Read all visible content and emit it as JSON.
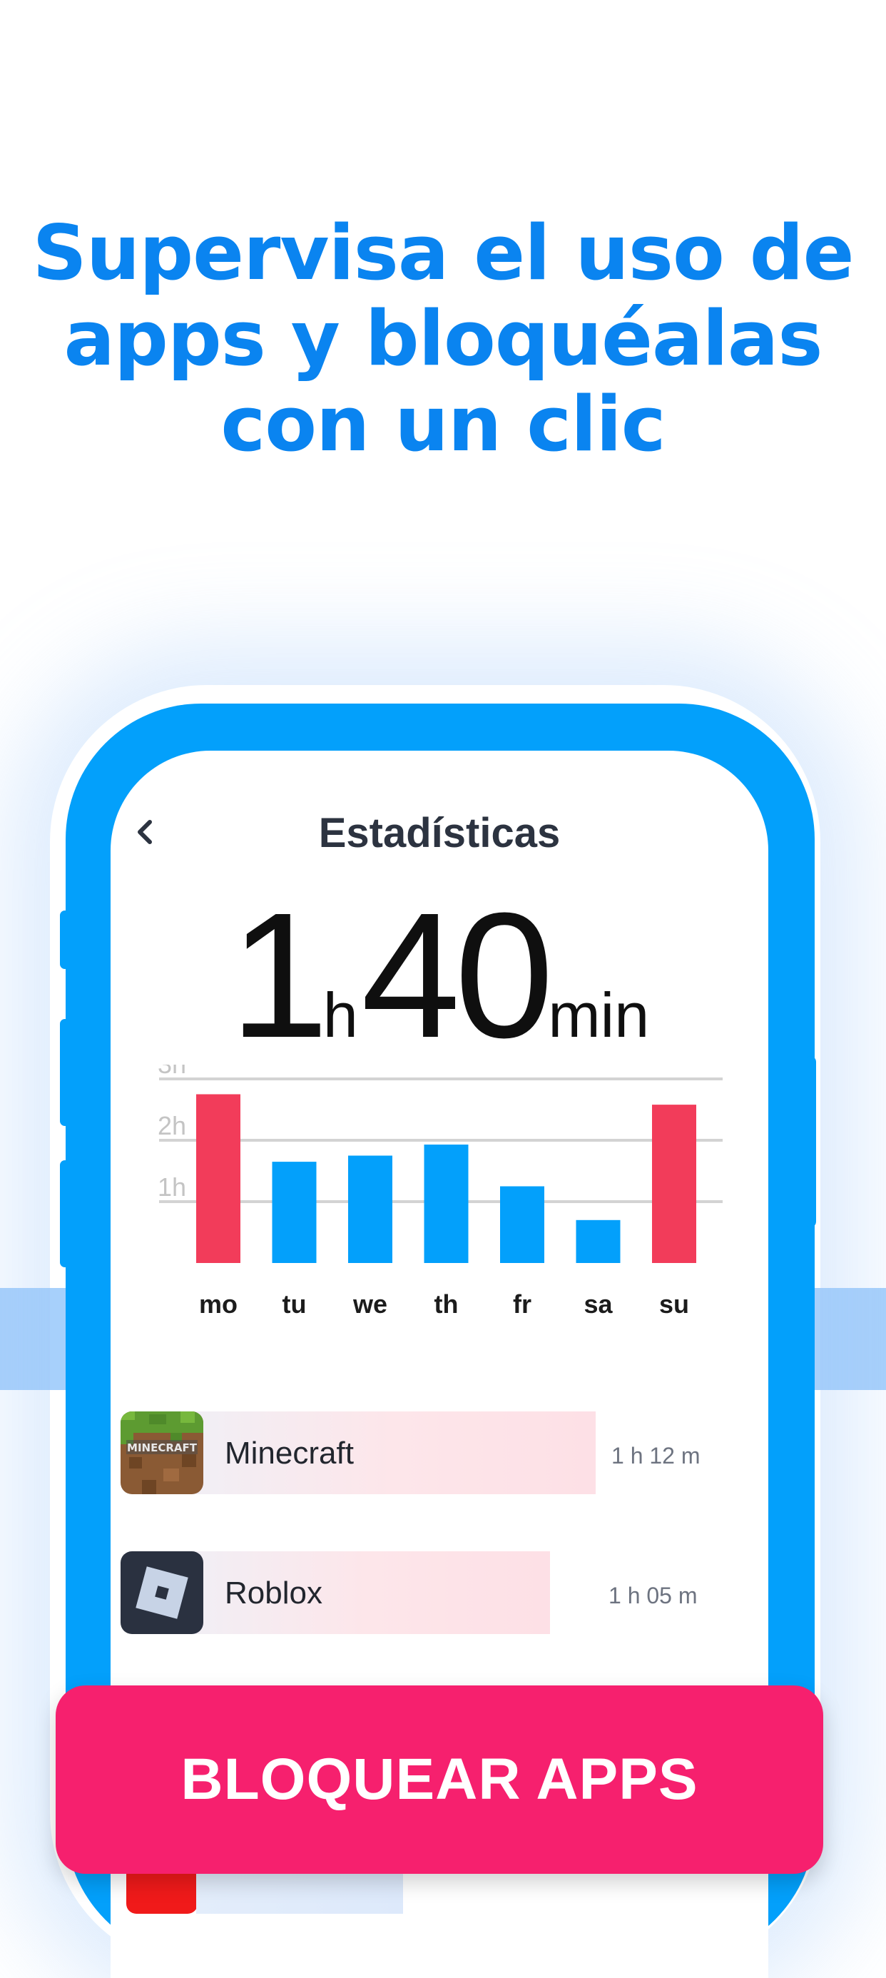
{
  "headline": {
    "line1": "Supervisa el uso de",
    "line2": "apps y bloquéalas",
    "line3": "con un clic"
  },
  "screen": {
    "title": "Estadísticas",
    "back_icon": "chevron-left-icon",
    "total": {
      "hours": "1",
      "hours_unit": "h",
      "minutes": "40",
      "minutes_unit": "min"
    }
  },
  "chart_data": {
    "type": "bar",
    "categories": [
      "mo",
      "tu",
      "we",
      "th",
      "fr",
      "sa",
      "su"
    ],
    "values": [
      2.75,
      1.65,
      1.75,
      1.93,
      1.25,
      0.7,
      2.58
    ],
    "y_ticks": [
      "1h",
      "2h",
      "3h"
    ],
    "ylim": [
      0,
      3
    ],
    "colors": [
      "#f23c5a",
      "#03a0fb",
      "#03a0fb",
      "#03a0fb",
      "#03a0fb",
      "#03a0fb",
      "#f23c5a"
    ],
    "grid": true
  },
  "apps": [
    {
      "name": "Minecraft",
      "time": "1 h 12 m",
      "share": 1.0,
      "icon": "minecraft-icon"
    },
    {
      "name": "Roblox",
      "time": "1 h 05 m",
      "share": 0.9,
      "icon": "roblox-icon"
    }
  ],
  "cta": {
    "label": "BLOQUEAR APPS"
  },
  "colors": {
    "headline": "#0a84f0",
    "phone": "#03a0fb",
    "cta": "#f6206e",
    "highlight_bar": "#f23c5a"
  }
}
